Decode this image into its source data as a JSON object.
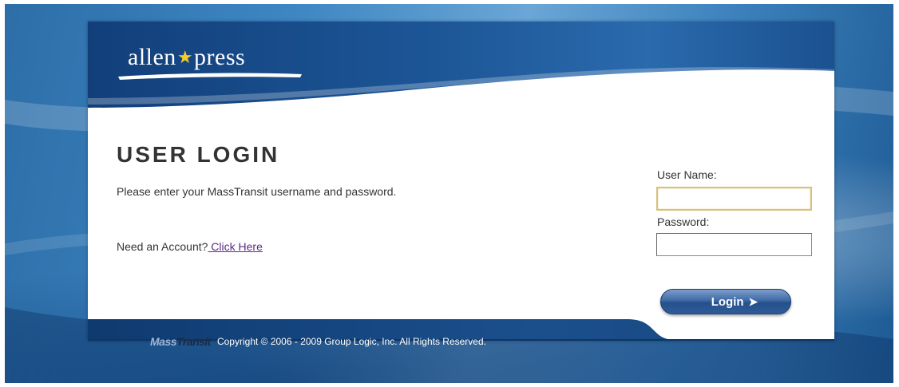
{
  "brand": {
    "logo_left": "allen",
    "logo_star": "★",
    "logo_right": "press",
    "accent_yellow": "#f2cc2a",
    "header_blue": "#1e5b95"
  },
  "login": {
    "title": "USER LOGIN",
    "instructions": "Please enter your MassTransit username and password.",
    "need_account_text": "Need an Account?",
    "click_here_link": " Click Here",
    "username_label": "User Name:",
    "username_value": "",
    "password_label": "Password:",
    "password_value": "",
    "login_button_label": "Login",
    "login_button_icon": "arrow-right-icon"
  },
  "footer": {
    "product_logo_mass": "Mass",
    "product_logo_transit": "Transit",
    "copyright": "Copyright © 2006 - 2009 Group Logic, Inc. All Rights Reserved."
  }
}
